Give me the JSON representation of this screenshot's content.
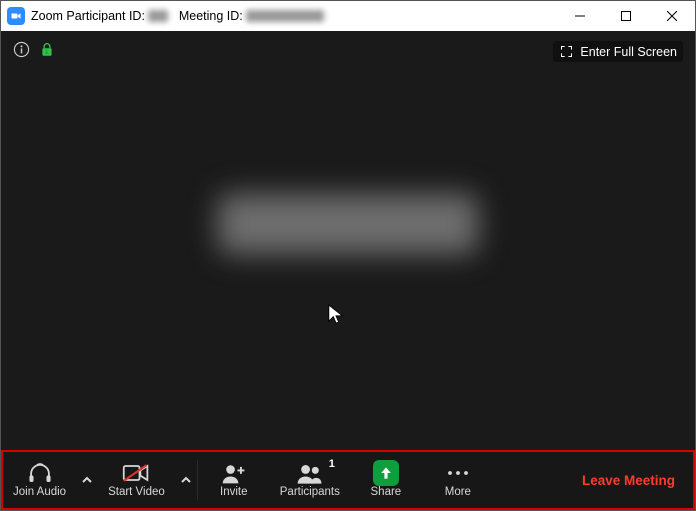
{
  "titlebar": {
    "prefix": "Zoom Participant ID: ",
    "mid": "   Meeting ID: "
  },
  "stage": {
    "fullscreen_label": "Enter Full Screen"
  },
  "toolbar": {
    "join_audio": "Join Audio",
    "start_video": "Start Video",
    "invite": "Invite",
    "participants": "Participants",
    "participants_count": "1",
    "share": "Share",
    "more": "More",
    "leave": "Leave Meeting"
  }
}
